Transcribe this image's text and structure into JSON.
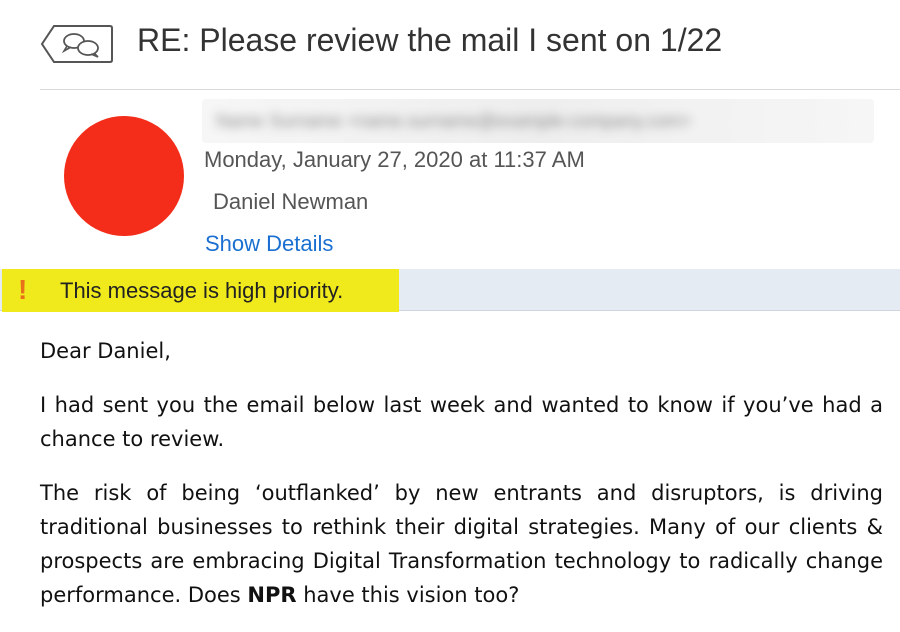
{
  "header": {
    "subject": "RE: Please review the mail I sent on 1/22",
    "icon": "conversation-icon"
  },
  "message": {
    "sender_blurred": "Name Surname <name.surname@example-company.com>",
    "date": "Monday, January 27, 2020 at 11:37 AM",
    "to": "Daniel Newman",
    "show_details": "Show Details",
    "avatar_color": "#f42d1a"
  },
  "priority": {
    "icon": "exclamation-icon",
    "text": "This message is high priority.",
    "highlight_color": "#f0ea1c"
  },
  "body": {
    "greeting": "Dear Daniel,",
    "para1": "I had sent you the email below last week and wanted to know if you’ve had a chance to review.",
    "para2_before": "The risk of being ‘outflanked’ by new entrants and disruptors, is driving traditional businesses to rethink their digital strategies. Many of our clients & prospects are embracing Digital Transformation technology to radically change performance. Does ",
    "para2_bold": "NPR",
    "para2_after": " have this vision too?"
  }
}
